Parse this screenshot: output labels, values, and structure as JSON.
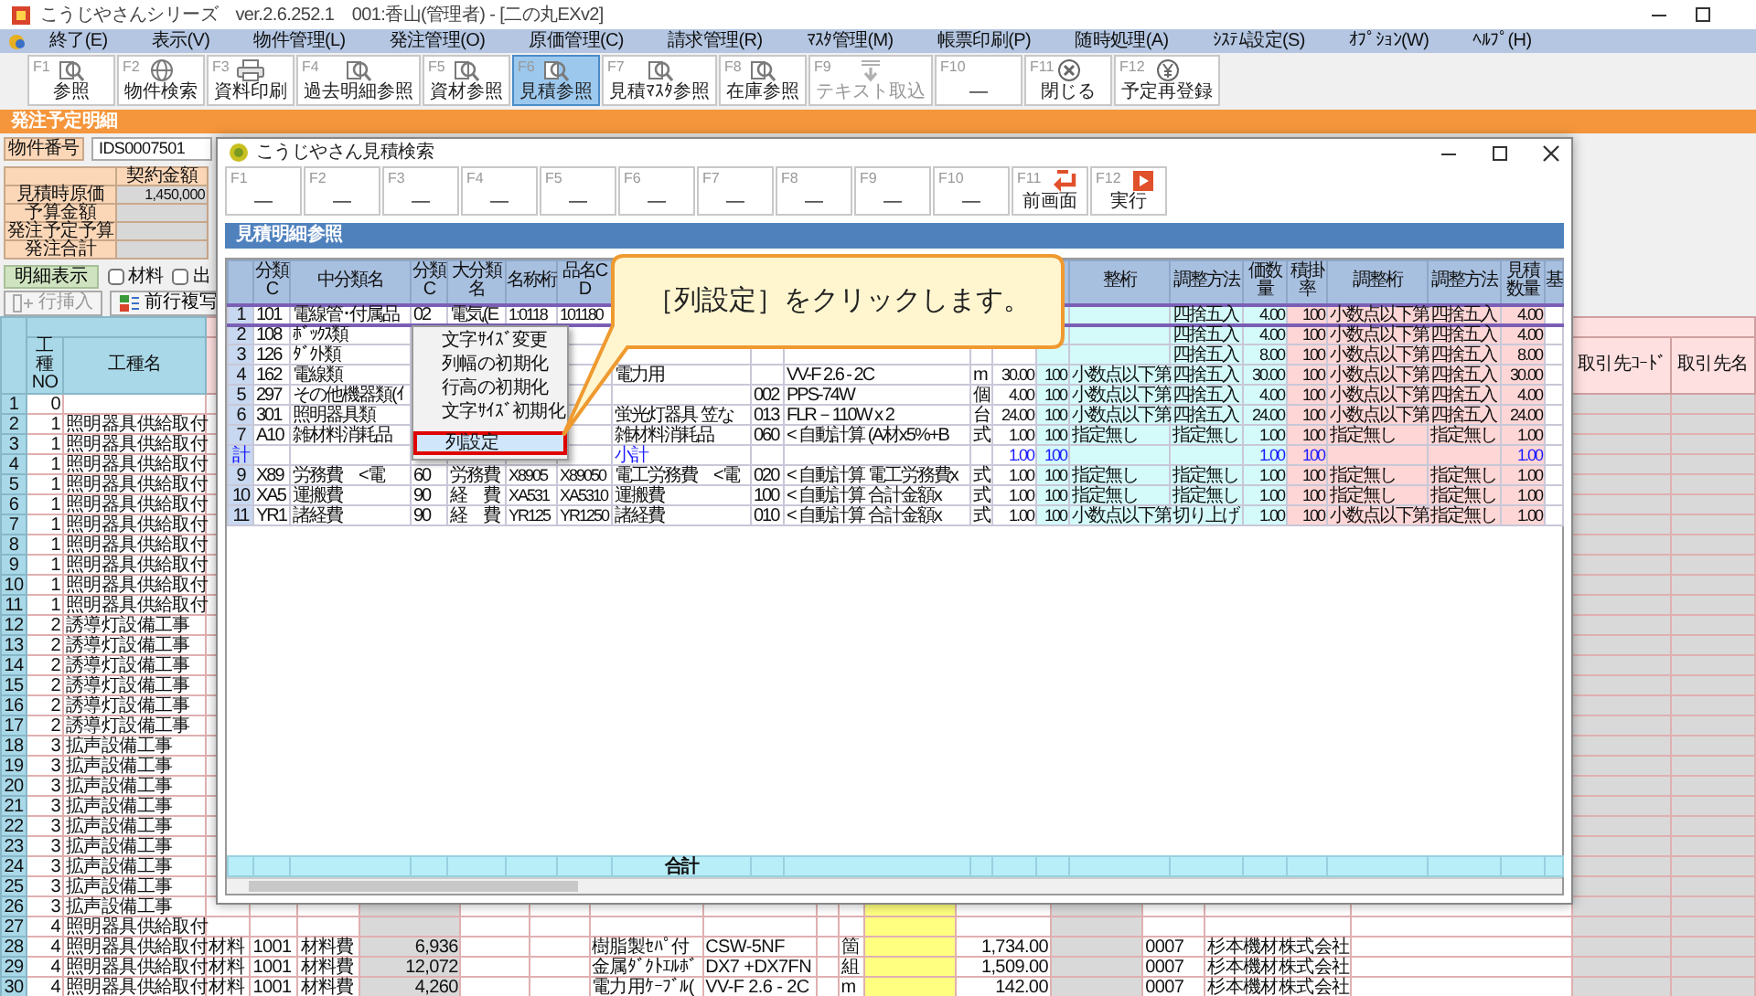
{
  "app_title": "こうじやさんシリーズ　ver.2.6.252.1　001:香山(管理者) - [二の丸EXv2]",
  "menu": [
    "終了(E)",
    "表示(V)",
    "物件管理(L)",
    "発注管理(O)",
    "原価管理(C)",
    "請求管理(R)",
    "ﾏｽﾀ管理(M)",
    "帳票印刷(P)",
    "随時処理(A)",
    "ｼｽﾃﾑ設定(S)",
    "ｵﾌﾟｼｮﾝ(W)",
    "ﾍﾙﾌﾟ(H)"
  ],
  "toolbar": [
    {
      "key": "F1",
      "label": "参照",
      "selected": false,
      "disabled": false
    },
    {
      "key": "F2",
      "label": "物件検索",
      "selected": false,
      "disabled": false
    },
    {
      "key": "F3",
      "label": "資料印刷",
      "selected": false,
      "disabled": false
    },
    {
      "key": "F4",
      "label": "過去明細参照",
      "selected": false,
      "disabled": false
    },
    {
      "key": "F5",
      "label": "資材参照",
      "selected": false,
      "disabled": false
    },
    {
      "key": "F6",
      "label": "見積参照",
      "selected": true,
      "disabled": false
    },
    {
      "key": "F7",
      "label": "見積ﾏｽﾀ参照",
      "selected": false,
      "disabled": false
    },
    {
      "key": "F8",
      "label": "在庫参照",
      "selected": false,
      "disabled": false
    },
    {
      "key": "F9",
      "label": "テキスト取込",
      "selected": false,
      "disabled": true
    },
    {
      "key": "F10",
      "label": "—",
      "selected": false,
      "disabled": false
    },
    {
      "key": "F11",
      "label": "閉じる",
      "selected": false,
      "disabled": false
    },
    {
      "key": "F12",
      "label": "予定再登録",
      "selected": false,
      "disabled": false
    }
  ],
  "panel_title": "発注予定明細",
  "order": {
    "number_label": "物件番号",
    "number": "IDS0007501",
    "amount_header": "契約金額",
    "amounts": [
      {
        "label": "見積時原価",
        "value": "1,450,000"
      },
      {
        "label": "予算金額"
      },
      {
        "label": "発注予定予算"
      },
      {
        "label": "発注合計"
      }
    ],
    "detail_button": "明細表示",
    "filters": [
      {
        "label": "材料",
        "checked": false
      },
      {
        "label": "出",
        "checked": false
      }
    ],
    "actions": [
      {
        "label": "行挿入",
        "disabled": true
      },
      {
        "label": "前行複写",
        "disabled": false
      }
    ]
  },
  "grid": {
    "columns": [
      {
        "label": "工種NO"
      },
      {
        "label": "工種名"
      },
      {},
      {},
      {},
      {},
      {},
      {},
      {},
      {},
      {},
      {},
      {},
      {},
      {},
      {},
      {},
      {},
      {
        "label": "取引先ｺｰﾄﾞ"
      },
      {
        "label": "取引先名"
      }
    ],
    "rows": [
      {
        "n": "1",
        "cells": [
          "0"
        ]
      },
      {
        "n": "2",
        "cells": [
          "1",
          "照明器具供給取付"
        ]
      },
      {
        "n": "3",
        "cells": [
          "1",
          "照明器具供給取付"
        ]
      },
      {
        "n": "4",
        "cells": [
          "1",
          "照明器具供給取付"
        ]
      },
      {
        "n": "5",
        "cells": [
          "1",
          "照明器具供給取付"
        ]
      },
      {
        "n": "6",
        "cells": [
          "1",
          "照明器具供給取付"
        ]
      },
      {
        "n": "7",
        "cells": [
          "1",
          "照明器具供給取付"
        ]
      },
      {
        "n": "8",
        "cells": [
          "1",
          "照明器具供給取付"
        ]
      },
      {
        "n": "9",
        "cells": [
          "1",
          "照明器具供給取付"
        ]
      },
      {
        "n": "10",
        "cells": [
          "1",
          "照明器具供給取付"
        ]
      },
      {
        "n": "11",
        "cells": [
          "1",
          "照明器具供給取付"
        ]
      },
      {
        "n": "12",
        "cells": [
          "2",
          "誘導灯設備工事"
        ]
      },
      {
        "n": "13",
        "cells": [
          "2",
          "誘導灯設備工事"
        ]
      },
      {
        "n": "14",
        "cells": [
          "2",
          "誘導灯設備工事"
        ]
      },
      {
        "n": "15",
        "cells": [
          "2",
          "誘導灯設備工事"
        ]
      },
      {
        "n": "16",
        "cells": [
          "2",
          "誘導灯設備工事"
        ]
      },
      {
        "n": "17",
        "cells": [
          "2",
          "誘導灯設備工事"
        ]
      },
      {
        "n": "18",
        "cells": [
          "3",
          "拡声設備工事"
        ]
      },
      {
        "n": "19",
        "cells": [
          "3",
          "拡声設備工事"
        ]
      },
      {
        "n": "20",
        "cells": [
          "3",
          "拡声設備工事"
        ]
      },
      {
        "n": "21",
        "cells": [
          "3",
          "拡声設備工事"
        ]
      },
      {
        "n": "22",
        "cells": [
          "3",
          "拡声設備工事"
        ]
      },
      {
        "n": "23",
        "cells": [
          "3",
          "拡声設備工事"
        ]
      },
      {
        "n": "24",
        "cells": [
          "3",
          "拡声設備工事"
        ]
      },
      {
        "n": "25",
        "cells": [
          "3",
          "拡声設備工事"
        ]
      },
      {
        "n": "26",
        "cells": [
          "3",
          "拡声設備工事"
        ]
      },
      {
        "n": "27",
        "cells": [
          "4",
          "照明器具供給取付"
        ]
      },
      {
        "n": "28",
        "cells": [
          "4",
          "照明器具供給取付",
          "材料",
          "1001",
          "材料費",
          "6,936",
          null,
          null,
          "樹脂製ｾﾊﾟ付",
          "CSW-5NF",
          null,
          "箇",
          null,
          "1,734.00",
          null,
          "0007",
          "杉本機材株式会社"
        ]
      },
      {
        "n": "29",
        "cells": [
          "4",
          "照明器具供給取付",
          "材料",
          "1001",
          "材料費",
          "12,072",
          null,
          null,
          "金属ﾀﾞｸﾄｴﾙﾎﾞ",
          "DX7 +DX7FN",
          null,
          "組",
          null,
          "1,509.00",
          null,
          "0007",
          "杉本機材株式会社"
        ]
      },
      {
        "n": "30",
        "cells": [
          "4",
          "照明器具供給取付",
          "材料",
          "1001",
          "材料費",
          "4,260",
          null,
          null,
          "電力用ｹｰﾌﾞﾙ(",
          "VV-F 2.6 - 2C",
          null,
          "m",
          null,
          "142.00",
          null,
          "0007",
          "杉本機材株式会社"
        ]
      }
    ]
  },
  "dialog": {
    "title": "こうじやさん見積検索",
    "toolbar": [
      {
        "key": "F1",
        "label": "—"
      },
      {
        "key": "F2",
        "label": "—"
      },
      {
        "key": "F3",
        "label": "—"
      },
      {
        "key": "F4",
        "label": "—"
      },
      {
        "key": "F5",
        "label": "—"
      },
      {
        "key": "F6",
        "label": "—"
      },
      {
        "key": "F7",
        "label": "—"
      },
      {
        "key": "F8",
        "label": "—"
      },
      {
        "key": "F9",
        "label": "—"
      },
      {
        "key": "F10",
        "label": "—"
      },
      {
        "key": "F11",
        "label": "前画面"
      },
      {
        "key": "F12",
        "label": "実行"
      }
    ],
    "section": "見積明細参照",
    "columns": [
      {
        "label": "分類C"
      },
      {
        "label": "中分類名"
      },
      {
        "label": "分類C"
      },
      {
        "label": "大分類名"
      },
      {
        "label": "名称桁"
      },
      {
        "label": "品名CD"
      },
      {},
      {},
      {},
      {},
      {},
      {
        "color": "#d4fafa"
      },
      {
        "label": "整桁",
        "color": "#d4fafa"
      },
      {
        "label": "調整方法",
        "color": "#d4fafa"
      },
      {
        "label": "価数量",
        "color": "#d4fafa"
      },
      {
        "label": "積掛率",
        "color": "#ffd6d6"
      },
      {
        "label": "調整桁",
        "color": "#ffd6d6"
      },
      {
        "label": "調整方法",
        "color": "#ffd6d6"
      },
      {
        "label": "見積数量",
        "color": "#ffd6d6"
      },
      {
        "label": "基"
      }
    ],
    "rows": [
      {
        "n": "1",
        "kind": "item",
        "selected": true,
        "cells": [
          "101",
          "電線管･付属品",
          "02",
          "電気(E",
          "1:0118",
          "101180",
          null,
          null,
          null,
          null,
          null,
          null,
          null,
          "四捨五入",
          "4.00",
          "100",
          "小数点以下第",
          "四捨五入",
          "4.00",
          null
        ]
      },
      {
        "n": "2",
        "kind": "item",
        "selected": false,
        "cells": [
          "108",
          "ﾎﾞｯｸｽ類",
          null,
          null,
          null,
          null,
          null,
          null,
          null,
          null,
          null,
          null,
          null,
          "四捨五入",
          "4.00",
          "100",
          "小数点以下第",
          "四捨五入",
          "4.00",
          null
        ]
      },
      {
        "n": "3",
        "kind": "item",
        "selected": false,
        "cells": [
          "126",
          "ﾀﾞｸﾄ類",
          null,
          null,
          null,
          null,
          null,
          null,
          null,
          null,
          null,
          null,
          null,
          "四捨五入",
          "8.00",
          "100",
          "小数点以下第",
          "四捨五入",
          "8.00",
          null
        ]
      },
      {
        "n": "4",
        "kind": "item",
        "selected": false,
        "cells": [
          "162",
          "電線類",
          null,
          null,
          null,
          null,
          "電力用",
          null,
          "VV-F 2.6 - 2C",
          "m",
          "30.00",
          "100",
          "小数点以下第",
          "四捨五入",
          "30.00",
          "100",
          "小数点以下第",
          "四捨五入",
          "30.00",
          null
        ]
      },
      {
        "n": "5",
        "kind": "item",
        "selected": false,
        "cells": [
          "297",
          "その他機器類(ｲ",
          null,
          null,
          null,
          null,
          null,
          "002",
          "PPS-74W",
          "個",
          "4.00",
          "100",
          "小数点以下第",
          "四捨五入",
          "4.00",
          "100",
          "小数点以下第",
          "四捨五入",
          "4.00",
          null
        ]
      },
      {
        "n": "6",
        "kind": "item",
        "selected": false,
        "cells": [
          "301",
          "照明器具類",
          null,
          null,
          null,
          null,
          "蛍光灯器具 笠な",
          "013",
          "FLR－110W x 2",
          "台",
          "24.00",
          "100",
          "小数点以下第",
          "四捨五入",
          "24.00",
          "100",
          "小数点以下第",
          "四捨五入",
          "24.00",
          null
        ]
      },
      {
        "n": "7",
        "kind": "item",
        "selected": false,
        "cells": [
          "A10",
          "雑材料消耗品",
          null,
          null,
          null,
          null,
          "雑材料消耗品",
          "060",
          "< 自動計算 (A材x5%+B",
          "式",
          "1.00",
          "100",
          "指定無し",
          "指定無し",
          "1.00",
          "100",
          "指定無し",
          "指定無し",
          "1.00",
          null
        ]
      },
      {
        "n": "計",
        "kind": "subtotal",
        "selected": false,
        "cells": [
          null,
          null,
          null,
          null,
          null,
          null,
          "小計",
          null,
          null,
          null,
          "1.00",
          "100",
          null,
          null,
          "1.00",
          "100",
          null,
          null,
          "1.00",
          null
        ]
      },
      {
        "n": "9",
        "kind": "item",
        "selected": false,
        "cells": [
          "X89",
          "労務費　<電",
          "60",
          "労務費",
          "X8905",
          "X89050",
          "電工労務費　<電",
          "020",
          "< 自動計算 電工労務費x",
          "式",
          "1.00",
          "100",
          "指定無し",
          "指定無し",
          "1.00",
          "100",
          "指定無し",
          "指定無し",
          "1.00",
          null
        ]
      },
      {
        "n": "10",
        "kind": "item",
        "selected": false,
        "cells": [
          "XA5",
          "運搬費",
          "90",
          "経　費",
          "XA531",
          "XA5310",
          "運搬費",
          "100",
          "< 自動計算 合計金額x",
          "式",
          "1.00",
          "100",
          "指定無し",
          "指定無し",
          "1.00",
          "100",
          "指定無し",
          "指定無し",
          "1.00",
          null
        ]
      },
      {
        "n": "11",
        "kind": "item",
        "selected": false,
        "cells": [
          "YR1",
          "諸経費",
          "90",
          "経　費",
          "YR125",
          "YR1250",
          "諸経費",
          "010",
          "< 自動計算 合計金額x",
          "式",
          "1.00",
          "100",
          "小数点以下第",
          "切り上げ",
          "1.00",
          "100",
          "小数点以下第",
          "指定無し",
          "1.00",
          null
        ]
      }
    ],
    "total_label": "合計",
    "context_menu": [
      {
        "label": "文字ｻｲｽﾞ変更",
        "selected": false,
        "emphasized": false
      },
      {
        "label": "列幅の初期化",
        "selected": false,
        "emphasized": false
      },
      {
        "label": "行高の初期化",
        "selected": false,
        "emphasized": false
      },
      {
        "label": "文字ｻｲｽﾞ初期化",
        "selected": false,
        "emphasized": false
      },
      {
        "label": "列設定",
        "selected": true,
        "emphasized": true
      }
    ],
    "callout": "［列設定］をクリックします。"
  }
}
